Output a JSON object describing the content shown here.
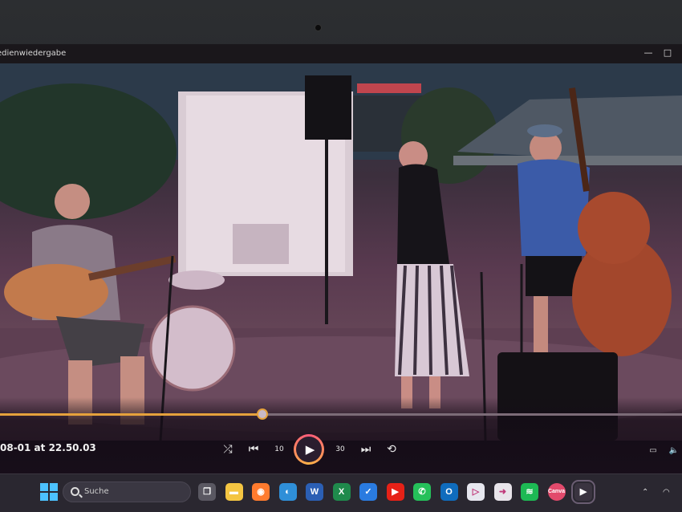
{
  "window": {
    "title": "edienwiedergabe",
    "minimize_glyph": "—",
    "maximize_glyph": "□"
  },
  "player": {
    "filename": "08-01 at 22.50.03",
    "progress_fraction": 0.385,
    "buttons": {
      "shuffle": "⤮",
      "previous": "⏮",
      "rewind": "10",
      "play": "▶",
      "forward": "30",
      "next": "⏭",
      "repeat": "⟲"
    },
    "right_controls": {
      "miniplayer": "▭",
      "volume": "🔈"
    }
  },
  "taskbar": {
    "search_placeholder": "Suche",
    "apps": [
      {
        "name": "task-view",
        "glyph": "❐",
        "color": "#5a5862"
      },
      {
        "name": "file-explorer",
        "glyph": "▬",
        "color": "#f4c542"
      },
      {
        "name": "firefox",
        "glyph": "◉",
        "color": "#ff7b2e"
      },
      {
        "name": "edge",
        "glyph": "◐",
        "color": "#2f8fd8"
      },
      {
        "name": "word",
        "glyph": "W",
        "color": "#2b5fb4"
      },
      {
        "name": "excel",
        "glyph": "X",
        "color": "#1f8a4c"
      },
      {
        "name": "outlook-check",
        "glyph": "✓",
        "color": "#2a7be0"
      },
      {
        "name": "youtube",
        "glyph": "▶",
        "color": "#e62117"
      },
      {
        "name": "whatsapp",
        "glyph": "✆",
        "color": "#25c05a"
      },
      {
        "name": "outlook",
        "glyph": "O",
        "color": "#0f6cbd"
      },
      {
        "name": "media-store",
        "glyph": "▷",
        "color": "#e7e7ef"
      },
      {
        "name": "forward-app",
        "glyph": "➜",
        "color": "#e8e4ea"
      },
      {
        "name": "spotify",
        "glyph": "≋",
        "color": "#1db954"
      },
      {
        "name": "canva",
        "glyph": "Canva",
        "color": "#e24a6c"
      },
      {
        "name": "media-player",
        "glyph": "▶",
        "color": "#3a3440"
      }
    ],
    "tray": {
      "chevron": "⌃",
      "wifi": "◠"
    }
  }
}
